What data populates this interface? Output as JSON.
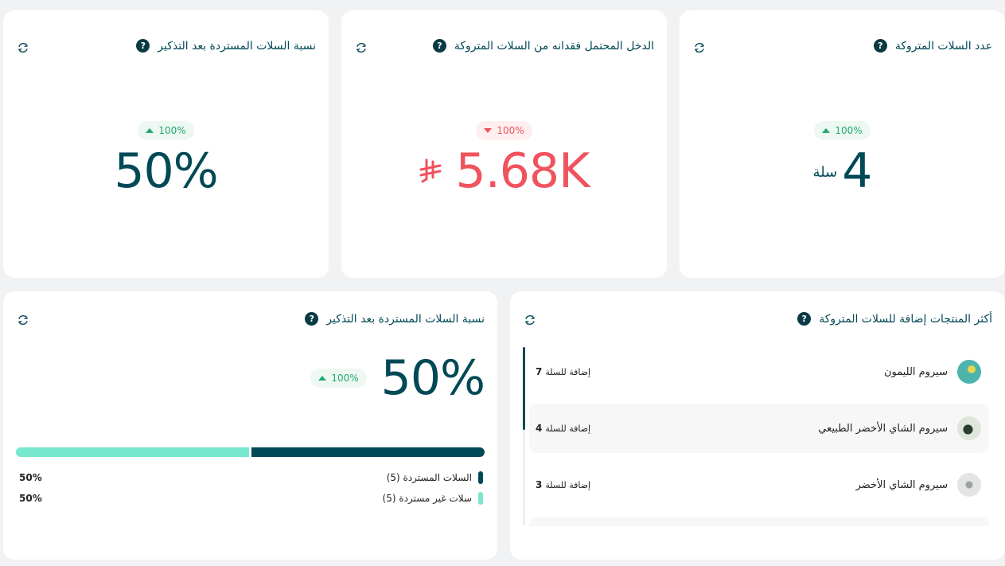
{
  "colors": {
    "primary": "#004956",
    "accent": "#76e8cd",
    "positive": "#1fa971",
    "negative": "#f0535e"
  },
  "cards": {
    "abandoned_count": {
      "title": "عدد السلات المتروكة",
      "badge": "100%",
      "badge_trend": "up",
      "value": "4",
      "unit": "سلة"
    },
    "lost_income": {
      "title": "الدخل المحتمل فقدانه من السلات المتروكة",
      "badge": "100%",
      "badge_trend": "down",
      "value": "5.68K",
      "currency_icon": "riyal-icon"
    },
    "recovery_rate_small": {
      "title": "نسبة السلات المستردة بعد التذكير",
      "badge": "100%",
      "badge_trend": "up",
      "value": "50%"
    },
    "top_products": {
      "title": "أكثر المنتجات إضافة للسلات المتروكة",
      "items": [
        {
          "name": "سيروم الليمون",
          "count": "7",
          "count_label": "إضافة للسلة"
        },
        {
          "name": "سيروم الشاي الأخضر الطبيعي",
          "count": "4",
          "count_label": "إضافة للسلة"
        },
        {
          "name": "سيروم الشاي الأخضر",
          "count": "3",
          "count_label": "إضافة للسلة"
        }
      ]
    },
    "recovery_rate": {
      "title": "نسبة السلات المستردة بعد التذكير",
      "badge": "100%",
      "badge_trend": "up",
      "value": "50%",
      "progress": {
        "recovered_fraction": 0.5,
        "unrecovered_fraction": 0.5
      },
      "legend": [
        {
          "label": "السلات المستردة (5)",
          "pct": "50%",
          "color": "#004956"
        },
        {
          "label": "سلات غير مستردة (5)",
          "pct": "50%",
          "color": "#76e8cd"
        }
      ]
    }
  },
  "icons": {
    "help": "?",
    "refresh": "refresh-icon"
  }
}
